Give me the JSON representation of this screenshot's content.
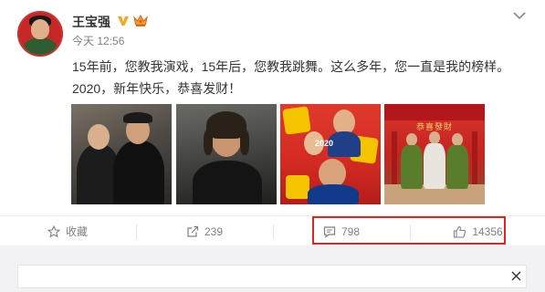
{
  "post": {
    "user_name": "王宝强",
    "verified_icon": "verified-v-icon",
    "vip_icon": "vip-crown-icon",
    "time": "今天 12:56",
    "text_line1": "15年前，您教我演戏，15年后，您教我跳舞。这么多年，您一直是我的榜样。",
    "text_line2": "2020，新年快乐，恭喜发财！",
    "photos": [
      {
        "watermark": ""
      },
      {
        "watermark": ""
      },
      {
        "overlay_text": "2020"
      },
      {
        "overlay_text": "恭喜發財"
      }
    ]
  },
  "actions": {
    "favorite_label": "收藏",
    "share_count": "239",
    "comment_count": "798",
    "like_count": "14356"
  },
  "colors": {
    "highlight": "#e3251f",
    "verified": "#f5a623",
    "accent_red": "#d32f2f"
  }
}
